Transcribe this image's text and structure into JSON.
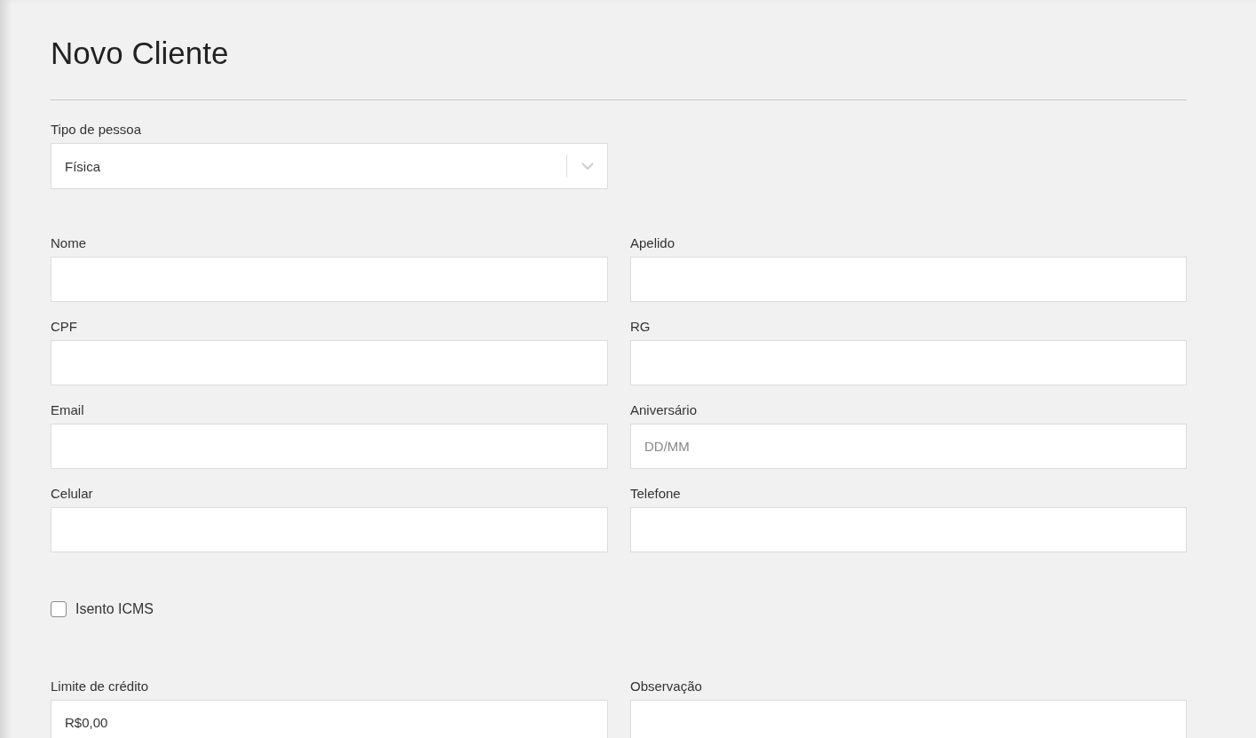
{
  "title": "Novo Cliente",
  "person_type": {
    "label": "Tipo de pessoa",
    "value": "Física"
  },
  "fields": [
    {
      "label": "Nome"
    },
    {
      "label": "Apelido"
    },
    {
      "label": "CPF"
    },
    {
      "label": "RG"
    },
    {
      "label": "Email"
    },
    {
      "label": "Aniversário",
      "placeholder": "DD/MM"
    },
    {
      "label": "Celular"
    },
    {
      "label": "Telefone"
    }
  ],
  "icms_exempt": {
    "label": "Isento ICMS",
    "checked": false
  },
  "bottom_fields": [
    {
      "label": "Limite de crédito",
      "value": "R$0,00"
    },
    {
      "label": "Observação"
    }
  ]
}
